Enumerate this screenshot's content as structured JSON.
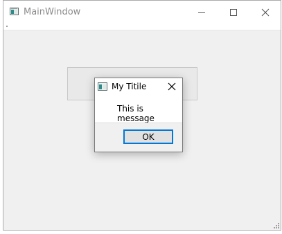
{
  "main_window": {
    "title": "MainWindow",
    "controls": {
      "minimize": "minimize-icon",
      "maximize": "maximize-icon",
      "close": "close-icon"
    }
  },
  "dialog": {
    "title": "My Titile",
    "message": "This is message",
    "ok_label": "OK",
    "close_icon": "close-icon"
  },
  "colors": {
    "focus_accent": "#0078d7",
    "window_bg": "#f0f0f0"
  }
}
